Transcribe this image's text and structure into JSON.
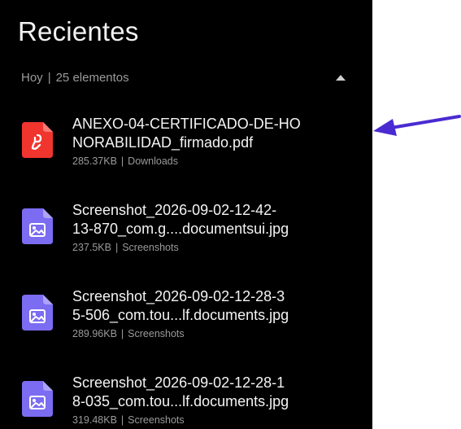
{
  "header": {
    "title": "Recientes"
  },
  "group": {
    "label": "Hoy",
    "separator": "|",
    "count": "25 elementos"
  },
  "files": [
    {
      "name_line1": "ANEXO-04-CERTIFICADO-DE-HO",
      "name_line2": "NORABILIDAD_firmado.pdf",
      "size": "285.37KB",
      "separator": "|",
      "location": "Downloads",
      "icon": "pdf-icon",
      "icon_color": "#f0352f"
    },
    {
      "name_line1": "Screenshot_2026-09-02-12-42-",
      "name_line2": "13-870_com.g....documentsui.jpg",
      "size": "237.5KB",
      "separator": "|",
      "location": "Screenshots",
      "icon": "image-icon",
      "icon_color": "#7b6cf2"
    },
    {
      "name_line1": "Screenshot_2026-09-02-12-28-3",
      "name_line2": "5-506_com.tou...lf.documents.jpg",
      "size": "289.96KB",
      "separator": "|",
      "location": "Screenshots",
      "icon": "image-icon",
      "icon_color": "#7b6cf2"
    },
    {
      "name_line1": "Screenshot_2026-09-02-12-28-1",
      "name_line2": "8-035_com.tou...lf.documents.jpg",
      "size": "319.48KB",
      "separator": "|",
      "location": "Screenshots",
      "icon": "image-icon",
      "icon_color": "#7b6cf2"
    }
  ],
  "annotation": {
    "arrow_color": "#4a2bd1"
  }
}
